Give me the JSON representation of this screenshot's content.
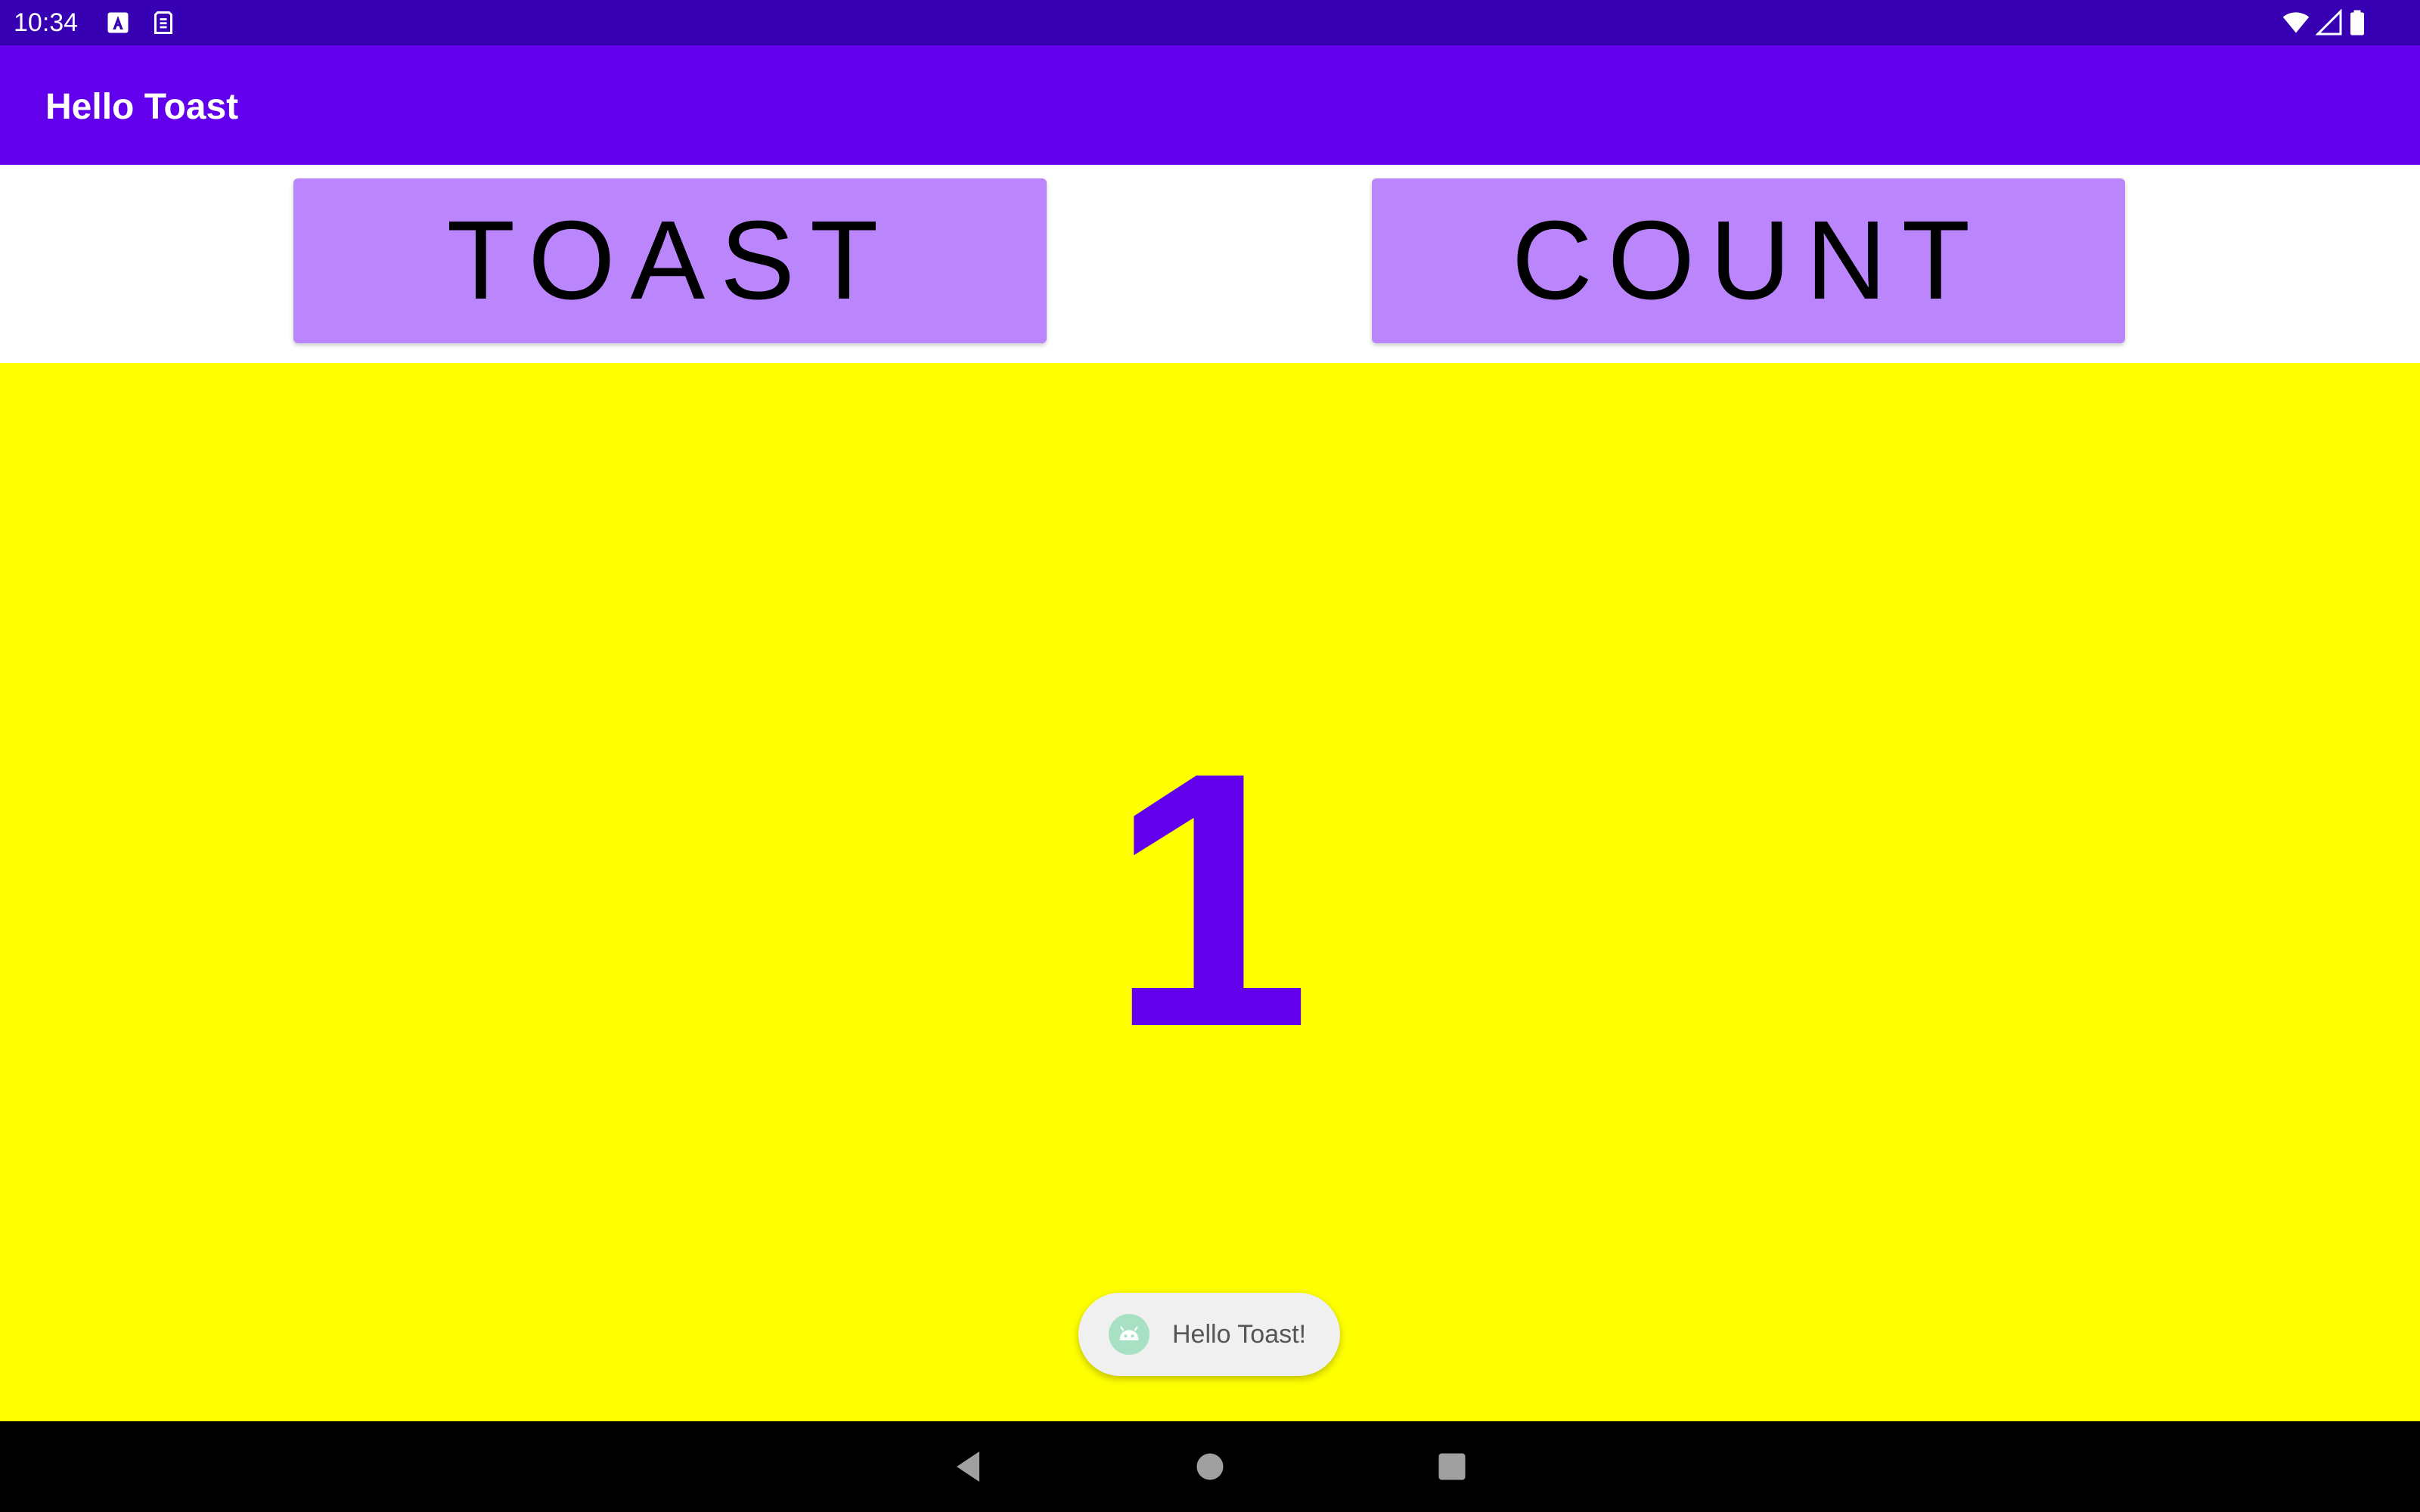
{
  "status_bar": {
    "time": "10:34",
    "icons": [
      "keyboard-a-icon",
      "sim-icon",
      "wifi-icon",
      "signal-icon",
      "battery-icon"
    ],
    "background": "#3700b3"
  },
  "app_bar": {
    "title": "Hello Toast",
    "background": "#6200ee"
  },
  "buttons": {
    "toast_label": "TOAST",
    "count_label": "COUNT",
    "background": "#bb86fc"
  },
  "count": {
    "value": "1",
    "background": "#ffff00",
    "text_color": "#6200ee"
  },
  "toast": {
    "icon": "android-icon",
    "message": "Hello Toast!"
  },
  "nav_bar": {
    "buttons": [
      "back-icon",
      "home-icon",
      "recents-icon"
    ]
  }
}
